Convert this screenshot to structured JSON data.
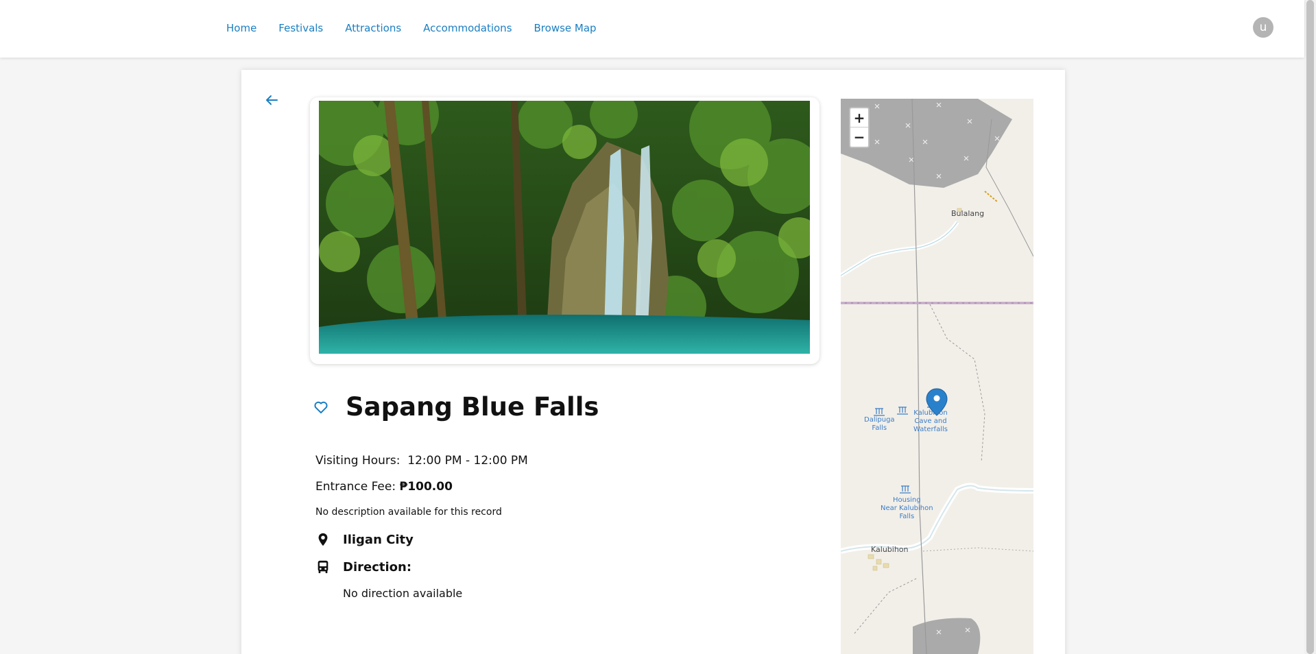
{
  "nav": {
    "items": [
      "Home",
      "Festivals",
      "Attractions",
      "Accommodations",
      "Browse Map"
    ],
    "avatar_letter": "u"
  },
  "attraction": {
    "name": "Sapang Blue Falls",
    "visiting_hours_label": "Visiting Hours:",
    "visiting_hours": "12:00 PM - 12:00 PM",
    "fee_label": "Entrance Fee:",
    "fee": "₱100.00",
    "description": "No description available for this record",
    "location": "Iligan City",
    "direction_label": "Direction:",
    "direction": "No direction available"
  },
  "map": {
    "zoom_in": "+",
    "zoom_out": "−",
    "labels": {
      "bulalang": "Bulalang",
      "dalipuga_1": "Dalipuga",
      "dalipuga_2": "Falls",
      "kalubihon_cave_1": "Kalubihon",
      "kalubihon_cave_2": "Cave and",
      "kalubihon_cave_3": "Waterfalls",
      "housing_1": "Housing",
      "housing_2": "Near Kalubihon",
      "housing_3": "Falls",
      "kalubihon": "Kalubihon"
    }
  },
  "colors": {
    "accent": "#1a7fc1",
    "map_bg": "#f2efe9",
    "quarry": "#aaaaaa",
    "marker": "#2a81cb"
  }
}
